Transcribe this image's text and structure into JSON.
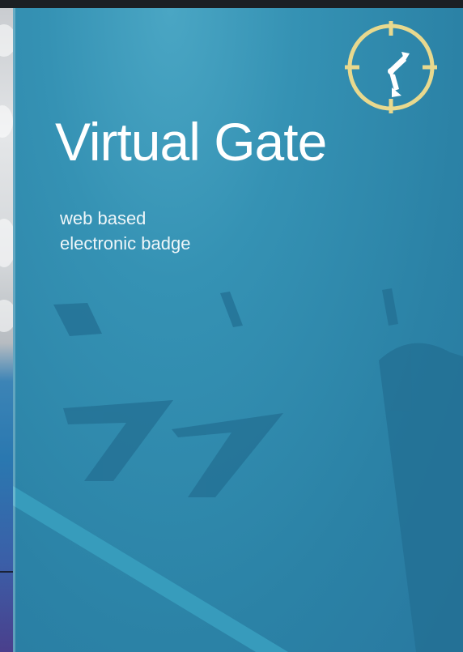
{
  "brand": {
    "title": "Virtual Gate",
    "subtitle_line1": "web based",
    "subtitle_line2": "electronic badge",
    "logo_icon": "clock-crosshair-icon",
    "colors": {
      "panel": "#2b82a6",
      "logo": "#e8d98e",
      "text": "#ffffff"
    }
  }
}
